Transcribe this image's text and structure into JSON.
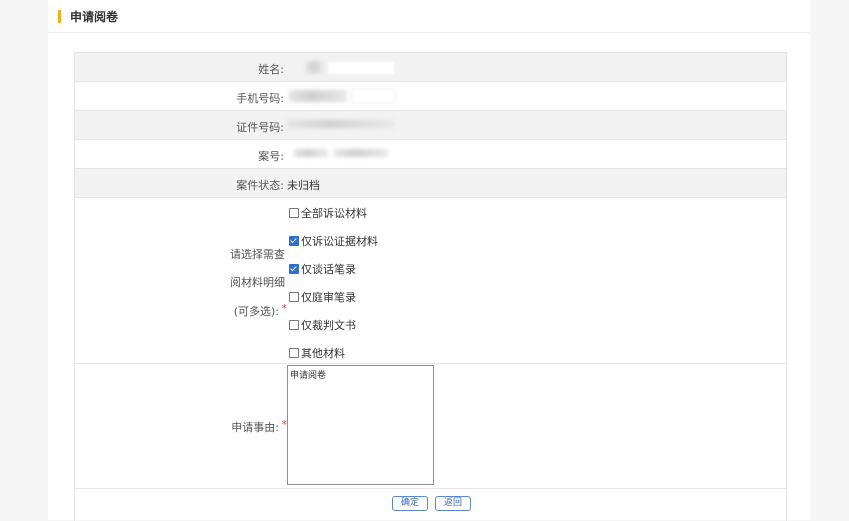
{
  "panel": {
    "title": "申请阅卷"
  },
  "fields": {
    "name": {
      "label": "姓名:"
    },
    "phone": {
      "label": "手机号码:"
    },
    "id_number": {
      "label": "证件号码:"
    },
    "case_number": {
      "label": "案号:"
    },
    "case_status": {
      "label": "案件状态:",
      "value": "未归档"
    },
    "materials": {
      "label_line1": "请选择需查",
      "label_line2": "阅材料明细",
      "label_line3": "(可多选):",
      "required_mark": "*",
      "options": [
        {
          "label": "全部诉讼材料",
          "checked": false
        },
        {
          "label": "仅诉讼证据材料",
          "checked": true
        },
        {
          "label": "仅谈话笔录",
          "checked": true
        },
        {
          "label": "仅庭审笔录",
          "checked": false
        },
        {
          "label": "仅裁判文书",
          "checked": false
        },
        {
          "label": "其他材料",
          "checked": false
        }
      ]
    },
    "reason": {
      "label": "申请事由:",
      "required_mark": "*",
      "value": "申请阅卷"
    }
  },
  "buttons": {
    "confirm": "确定",
    "back": "返回"
  },
  "colors": {
    "accent": "#f2b01e",
    "checkbox_checked": "#2f6fd1",
    "button_border": "#5d86cf",
    "required": "#e04444"
  }
}
